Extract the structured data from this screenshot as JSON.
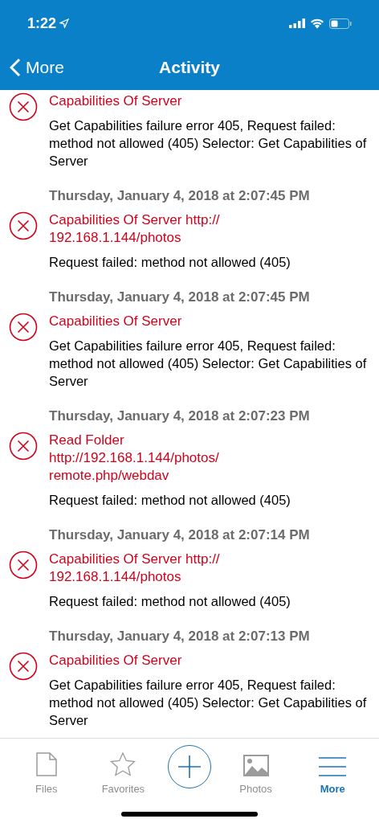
{
  "status_bar": {
    "time": "1:22"
  },
  "nav": {
    "back": "More",
    "title": "Activity"
  },
  "entries": [
    {
      "title": "Capabilities Of Server",
      "message": "Get Capabilities failure error 405, Request failed: method not allowed (405) Selector: Get Capabilities of Server"
    },
    {
      "timestamp": "Thursday, January 4, 2018 at 2:07:45 PM",
      "title": "Capabilities Of Server http:// 192.168.1.144/photos",
      "message": "Request failed: method not allowed (405)"
    },
    {
      "timestamp": "Thursday, January 4, 2018 at 2:07:45 PM",
      "title": "Capabilities Of Server",
      "message": "Get Capabilities failure error 405, Request failed: method not allowed (405) Selector: Get Capabilities of Server"
    },
    {
      "timestamp": "Thursday, January 4, 2018 at 2:07:23 PM",
      "title": "Read Folder http://192.168.1.144/photos/ remote.php/webdav",
      "message": "Request failed: method not allowed (405)"
    },
    {
      "timestamp": "Thursday, January 4, 2018 at 2:07:14 PM",
      "title": "Capabilities Of Server http:// 192.168.1.144/photos",
      "message": "Request failed: method not allowed (405)"
    },
    {
      "timestamp": "Thursday, January 4, 2018 at 2:07:13 PM",
      "title": "Capabilities Of Server",
      "message": "Get Capabilities failure error 405, Request failed: method not allowed (405) Selector: Get Capabilities of Server"
    }
  ],
  "tabs": [
    {
      "kind": "files",
      "label": "Files",
      "selected": false
    },
    {
      "kind": "favorites",
      "label": "Favorites",
      "selected": false
    },
    {
      "kind": "add",
      "selected": false
    },
    {
      "kind": "photos",
      "label": "Photos",
      "selected": false
    },
    {
      "kind": "more",
      "label": "More",
      "selected": true
    }
  ]
}
